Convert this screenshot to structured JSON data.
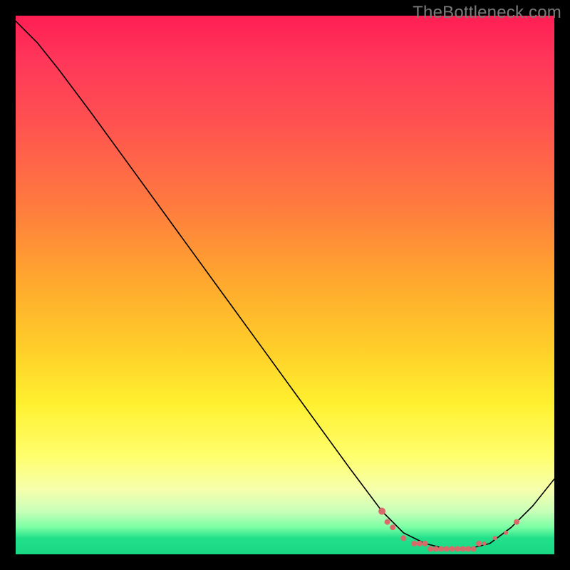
{
  "watermark": "TheBottleneck.com",
  "chart_data": {
    "type": "line",
    "title": "",
    "xlabel": "",
    "ylabel": "",
    "xlim": [
      0,
      100
    ],
    "ylim": [
      0,
      100
    ],
    "grid": false,
    "legend": false,
    "curve": [
      {
        "x": 0,
        "y": 99
      },
      {
        "x": 4,
        "y": 95
      },
      {
        "x": 8,
        "y": 90
      },
      {
        "x": 14,
        "y": 82
      },
      {
        "x": 22,
        "y": 71
      },
      {
        "x": 30,
        "y": 60
      },
      {
        "x": 38,
        "y": 49
      },
      {
        "x": 46,
        "y": 38
      },
      {
        "x": 54,
        "y": 27
      },
      {
        "x": 62,
        "y": 16
      },
      {
        "x": 68,
        "y": 8
      },
      {
        "x": 72,
        "y": 4
      },
      {
        "x": 76,
        "y": 2
      },
      {
        "x": 80,
        "y": 1
      },
      {
        "x": 84,
        "y": 1
      },
      {
        "x": 88,
        "y": 2
      },
      {
        "x": 92,
        "y": 5
      },
      {
        "x": 96,
        "y": 9
      },
      {
        "x": 100,
        "y": 14
      }
    ],
    "markers": [
      {
        "x": 68,
        "y": 8,
        "r": 5
      },
      {
        "x": 69,
        "y": 6,
        "r": 4
      },
      {
        "x": 70,
        "y": 5,
        "r": 4
      },
      {
        "x": 72,
        "y": 3,
        "r": 4
      },
      {
        "x": 74,
        "y": 2,
        "r": 4
      },
      {
        "x": 75,
        "y": 2,
        "r": 4
      },
      {
        "x": 76,
        "y": 2,
        "r": 4
      },
      {
        "x": 77,
        "y": 1,
        "r": 4
      },
      {
        "x": 78,
        "y": 1,
        "r": 4
      },
      {
        "x": 79,
        "y": 1,
        "r": 4
      },
      {
        "x": 80,
        "y": 1,
        "r": 4
      },
      {
        "x": 81,
        "y": 1,
        "r": 4
      },
      {
        "x": 82,
        "y": 1,
        "r": 4
      },
      {
        "x": 83,
        "y": 1,
        "r": 4
      },
      {
        "x": 84,
        "y": 1,
        "r": 4
      },
      {
        "x": 85,
        "y": 1,
        "r": 4
      },
      {
        "x": 86,
        "y": 2,
        "r": 4
      },
      {
        "x": 87,
        "y": 2,
        "r": 3
      },
      {
        "x": 89,
        "y": 3,
        "r": 3
      },
      {
        "x": 91,
        "y": 4,
        "r": 3
      },
      {
        "x": 93,
        "y": 6,
        "r": 4
      }
    ],
    "colors": {
      "curve": "#000000",
      "markers": "#d96a6a",
      "gradient_top": "#ff1e53",
      "gradient_mid": "#ffd22e",
      "gradient_bottom": "#18d785",
      "frame": "#000000"
    }
  }
}
